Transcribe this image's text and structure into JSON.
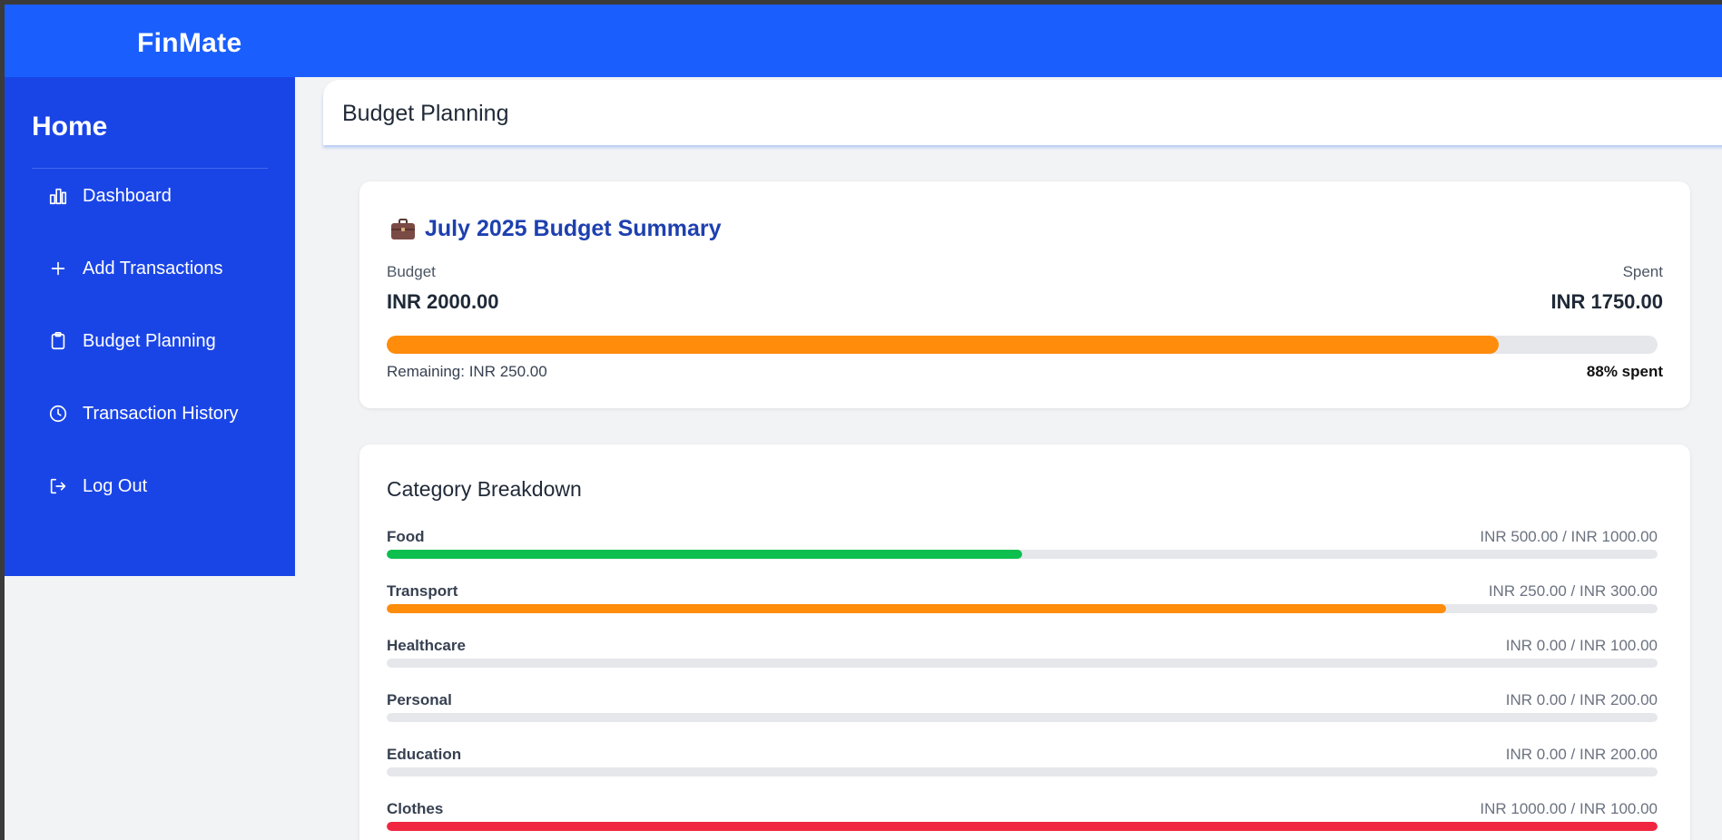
{
  "app": {
    "brand": "FinMate"
  },
  "sidebar": {
    "title": "Home",
    "items": [
      {
        "label": "Dashboard",
        "icon": "bar-chart-icon"
      },
      {
        "label": "Add Transactions",
        "icon": "plus-icon"
      },
      {
        "label": "Budget Planning",
        "icon": "clipboard-icon"
      },
      {
        "label": "Transaction History",
        "icon": "clock-icon"
      },
      {
        "label": "Log Out",
        "icon": "logout-icon"
      }
    ]
  },
  "page": {
    "title": "Budget Planning"
  },
  "summary": {
    "title": "July 2025 Budget Summary",
    "icon": "briefcase-icon",
    "budget_label": "Budget",
    "budget_value": "INR 2000.00",
    "spent_label": "Spent",
    "spent_value": "INR 1750.00",
    "progress": 0.875,
    "progress_color": "#ff8c0a",
    "remaining": "Remaining: INR 250.00",
    "percent_text": "88% spent"
  },
  "breakdown": {
    "title": "Category Breakdown",
    "categories": [
      {
        "name": "Food",
        "amount": "INR 500.00 / INR 1000.00",
        "progress": 0.5,
        "color": "#0dbf4f"
      },
      {
        "name": "Transport",
        "amount": "INR 250.00 / INR 300.00",
        "progress": 0.8333,
        "color": "#ff8c0a"
      },
      {
        "name": "Healthcare",
        "amount": "INR 0.00 / INR 100.00",
        "progress": 0,
        "color": "#0dbf4f"
      },
      {
        "name": "Personal",
        "amount": "INR 0.00 / INR 200.00",
        "progress": 0,
        "color": "#0dbf4f"
      },
      {
        "name": "Education",
        "amount": "INR 0.00 / INR 200.00",
        "progress": 0,
        "color": "#0dbf4f"
      },
      {
        "name": "Clothes",
        "amount": "INR 1000.00 / INR 100.00",
        "progress": 1,
        "color": "#f02640"
      }
    ]
  },
  "colors": {
    "topbar": "#1a5ffe",
    "sidebar": "#1a45e6",
    "accent_title": "#1e40af"
  }
}
